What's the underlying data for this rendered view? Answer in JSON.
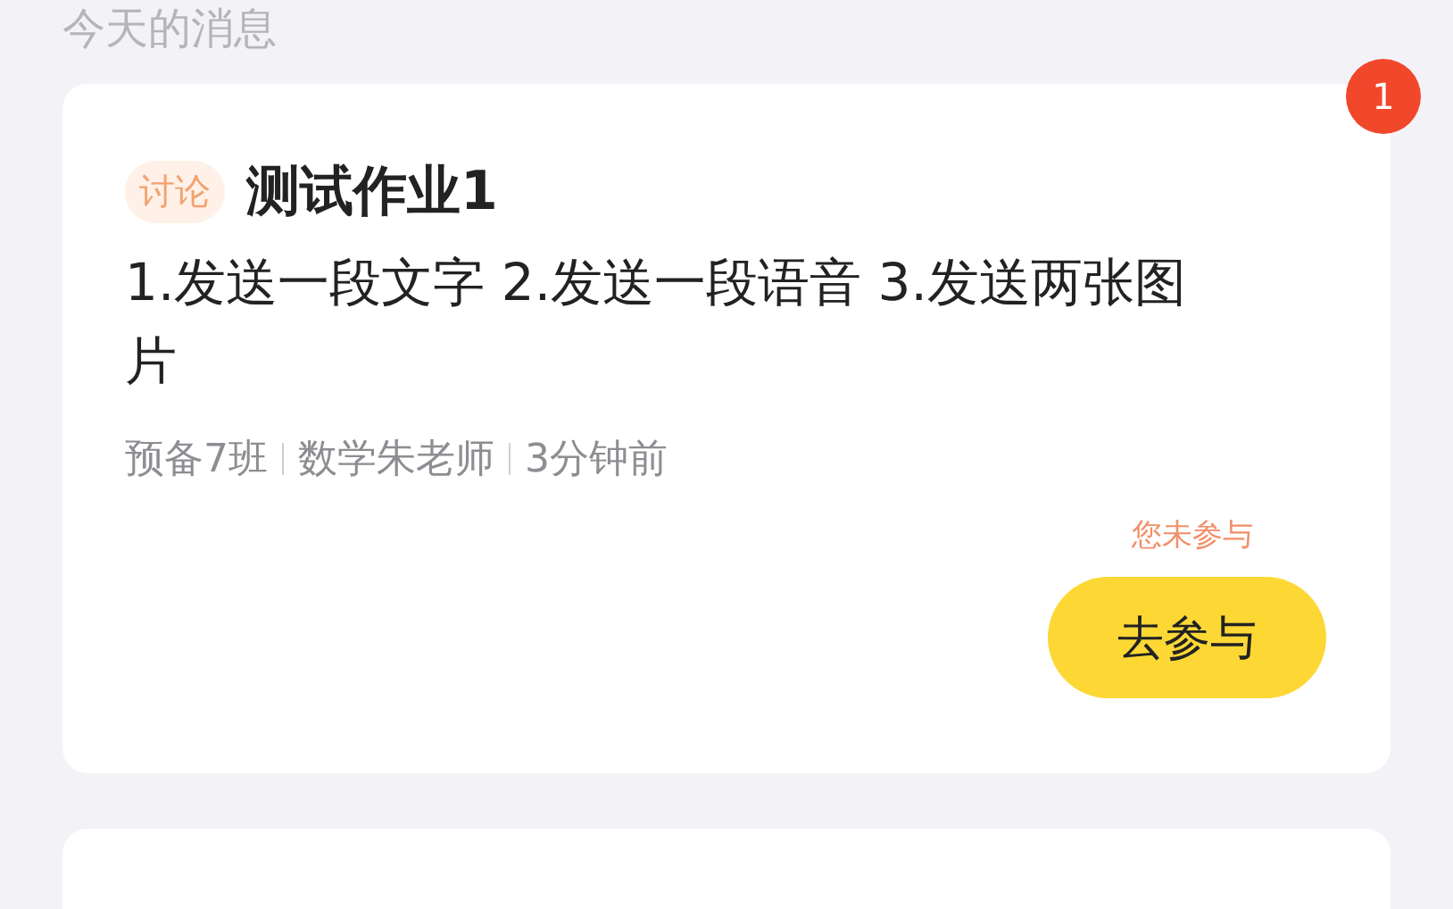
{
  "section_title": "今天的消息",
  "messages": [
    {
      "unread_count": "1",
      "tag": "讨论",
      "title": "测试作业1",
      "body": "1.发送一段文字 2.发送一段语音 3.发送两张图片",
      "meta": [
        "预备7班",
        "数学朱老师",
        "3分钟前"
      ],
      "status": "您未参与",
      "action": "去参与"
    }
  ]
}
